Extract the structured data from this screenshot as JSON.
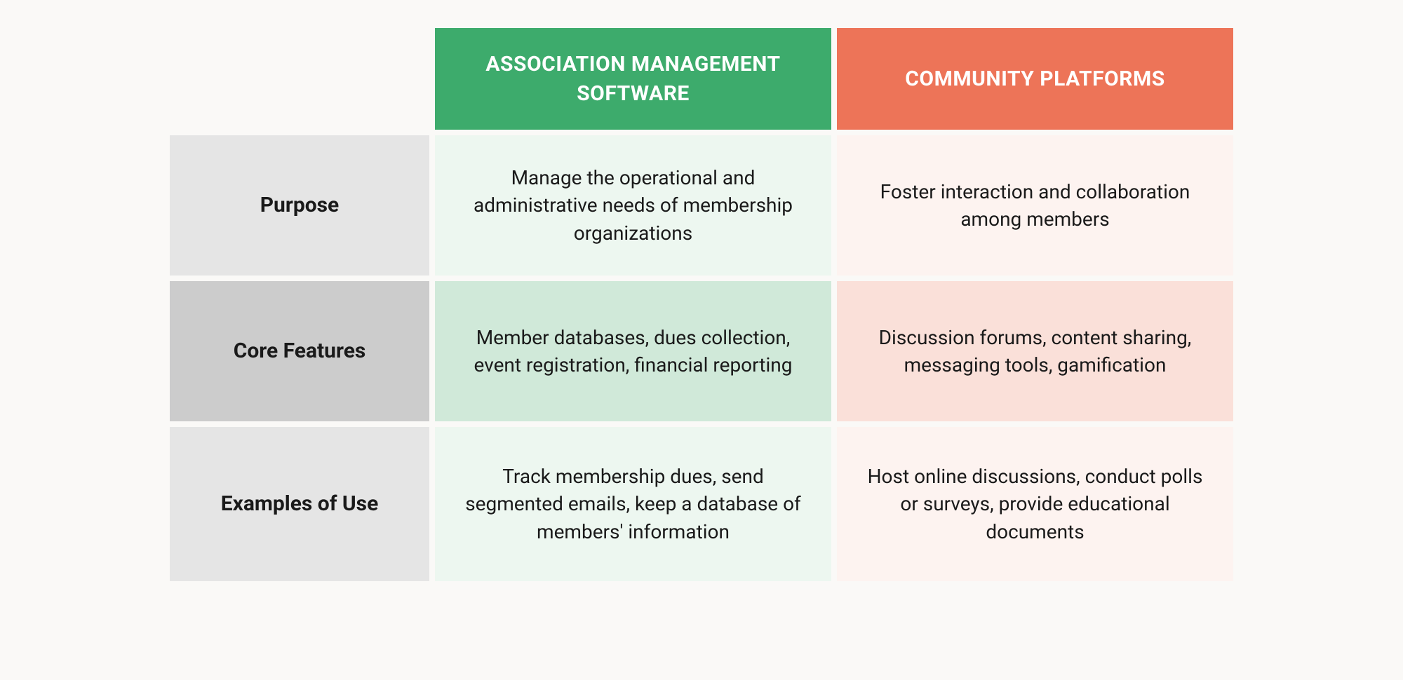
{
  "headers": {
    "col1": "ASSOCIATION MANAGEMENT SOFTWARE",
    "col2": "COMMUNITY PLATFORMS"
  },
  "rows": [
    {
      "label": "Purpose",
      "col1": "Manage the operational and administrative needs of membership organizations",
      "col2": "Foster interaction and collaboration among members"
    },
    {
      "label": "Core Features",
      "col1": "Member databases, dues collection, event registration, financial reporting",
      "col2": "Discussion forums, content sharing, messaging tools, gamification"
    },
    {
      "label": "Examples of Use",
      "col1": "Track membership dues, send segmented emails, keep a database of members' information",
      "col2": "Host online discussions, conduct polls or surveys, provide educational documents"
    }
  ]
}
